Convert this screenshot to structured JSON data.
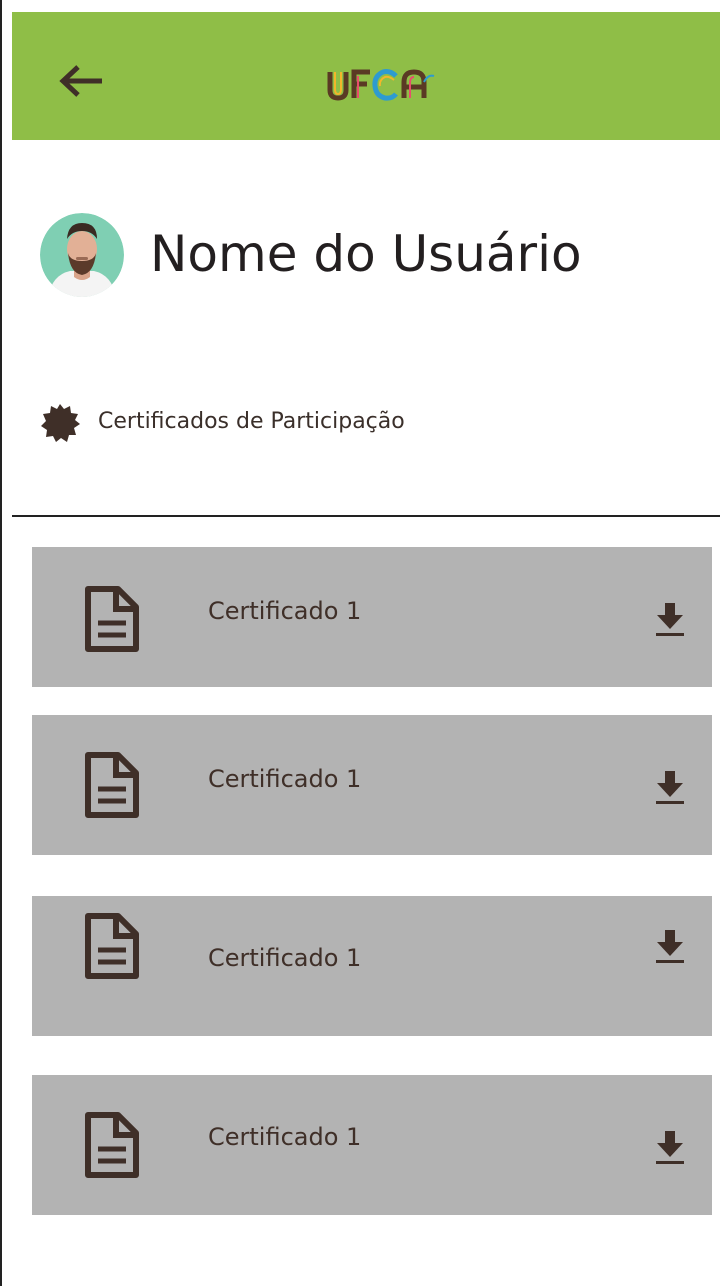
{
  "app": {
    "logo_text": "UFCA"
  },
  "header": {
    "back_icon": "arrow-left-icon",
    "background_color": "#8fbe47"
  },
  "user": {
    "name": "Nome do Usuário",
    "avatar_icon": "user-avatar"
  },
  "section": {
    "icon": "badge-icon",
    "title": "Certificados de Participação"
  },
  "certificates": [
    {
      "label": "Certificado 1",
      "icon": "document-icon",
      "action_icon": "download-icon"
    },
    {
      "label": "Certificado 1",
      "icon": "document-icon",
      "action_icon": "download-icon"
    },
    {
      "label": "Certificado 1",
      "icon": "document-icon",
      "action_icon": "download-icon"
    },
    {
      "label": "Certificado 1",
      "icon": "document-icon",
      "action_icon": "download-icon"
    }
  ],
  "colors": {
    "accent_green": "#8fbe47",
    "card_gray": "#b3b3b3",
    "icon_brown": "#3f2f28"
  }
}
